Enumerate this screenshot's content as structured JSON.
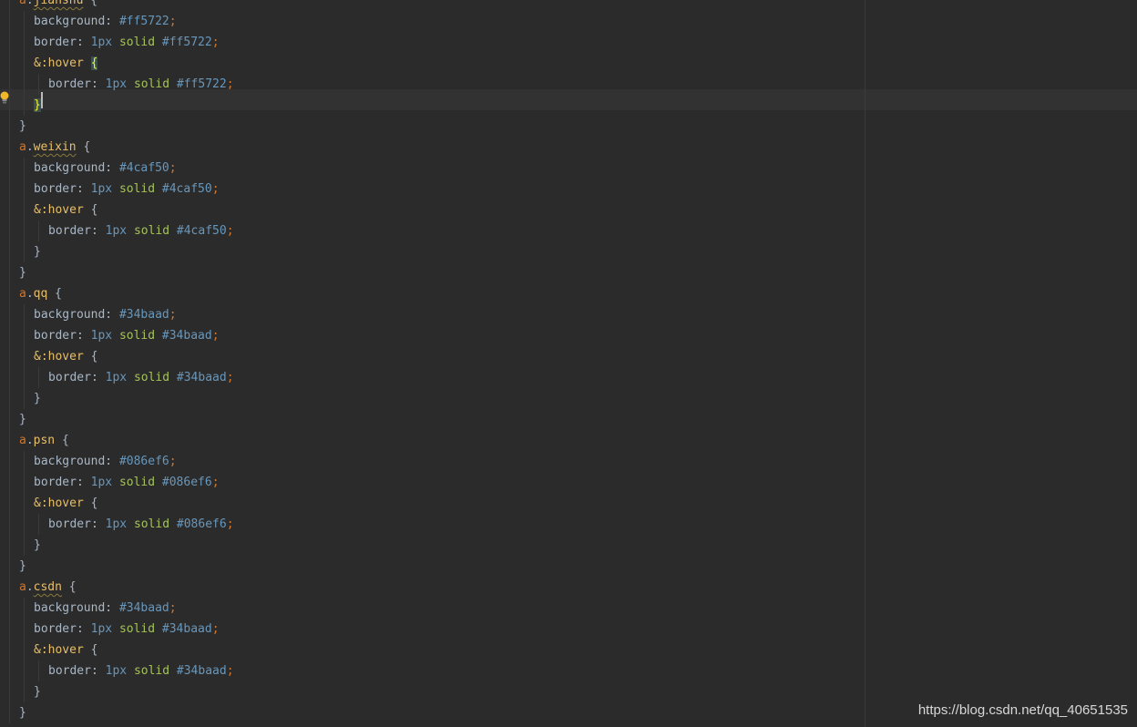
{
  "editor": {
    "language": "scss",
    "lines": [
      {
        "indent": 0,
        "tokens": [
          {
            "t": "a",
            "c": "kw"
          },
          {
            "t": ".",
            "c": "plain"
          },
          {
            "t": "jianshu",
            "c": "sel",
            "squiggle": true
          },
          {
            "t": " {",
            "c": "brace"
          }
        ]
      },
      {
        "indent": 1,
        "tokens": [
          {
            "t": "background",
            "c": "prop"
          },
          {
            "t": ": ",
            "c": "plain"
          },
          {
            "t": "#ff5722",
            "c": "hex"
          },
          {
            "t": ";",
            "c": "semi"
          }
        ]
      },
      {
        "indent": 1,
        "tokens": [
          {
            "t": "border",
            "c": "prop"
          },
          {
            "t": ": ",
            "c": "plain"
          },
          {
            "t": "1px",
            "c": "num"
          },
          {
            "t": " ",
            "c": "plain"
          },
          {
            "t": "solid",
            "c": "val"
          },
          {
            "t": " ",
            "c": "plain"
          },
          {
            "t": "#ff5722",
            "c": "hex"
          },
          {
            "t": ";",
            "c": "semi"
          }
        ]
      },
      {
        "indent": 1,
        "tokens": [
          {
            "t": "&:hover",
            "c": "sel"
          },
          {
            "t": " ",
            "c": "plain"
          },
          {
            "t": "{",
            "c": "brace-hl"
          }
        ]
      },
      {
        "indent": 2,
        "tokens": [
          {
            "t": "border",
            "c": "prop"
          },
          {
            "t": ": ",
            "c": "plain"
          },
          {
            "t": "1px",
            "c": "num"
          },
          {
            "t": " ",
            "c": "plain"
          },
          {
            "t": "solid",
            "c": "val"
          },
          {
            "t": " ",
            "c": "plain"
          },
          {
            "t": "#ff5722",
            "c": "hex"
          },
          {
            "t": ";",
            "c": "semi"
          }
        ]
      },
      {
        "indent": 1,
        "tokens": [
          {
            "t": "}",
            "c": "brace-hl"
          }
        ],
        "current": true
      },
      {
        "indent": 0,
        "tokens": [
          {
            "t": "}",
            "c": "brace"
          }
        ]
      },
      {
        "indent": 0,
        "tokens": [
          {
            "t": "a",
            "c": "kw"
          },
          {
            "t": ".",
            "c": "plain"
          },
          {
            "t": "weixin",
            "c": "sel",
            "squiggle": true
          },
          {
            "t": " {",
            "c": "brace"
          }
        ]
      },
      {
        "indent": 1,
        "tokens": [
          {
            "t": "background",
            "c": "prop"
          },
          {
            "t": ": ",
            "c": "plain"
          },
          {
            "t": "#4caf50",
            "c": "hex"
          },
          {
            "t": ";",
            "c": "semi"
          }
        ]
      },
      {
        "indent": 1,
        "tokens": [
          {
            "t": "border",
            "c": "prop"
          },
          {
            "t": ": ",
            "c": "plain"
          },
          {
            "t": "1px",
            "c": "num"
          },
          {
            "t": " ",
            "c": "plain"
          },
          {
            "t": "solid",
            "c": "val"
          },
          {
            "t": " ",
            "c": "plain"
          },
          {
            "t": "#4caf50",
            "c": "hex"
          },
          {
            "t": ";",
            "c": "semi"
          }
        ]
      },
      {
        "indent": 1,
        "tokens": [
          {
            "t": "&:hover",
            "c": "sel"
          },
          {
            "t": " {",
            "c": "brace"
          }
        ]
      },
      {
        "indent": 2,
        "tokens": [
          {
            "t": "border",
            "c": "prop"
          },
          {
            "t": ": ",
            "c": "plain"
          },
          {
            "t": "1px",
            "c": "num"
          },
          {
            "t": " ",
            "c": "plain"
          },
          {
            "t": "solid",
            "c": "val"
          },
          {
            "t": " ",
            "c": "plain"
          },
          {
            "t": "#4caf50",
            "c": "hex"
          },
          {
            "t": ";",
            "c": "semi"
          }
        ]
      },
      {
        "indent": 1,
        "tokens": [
          {
            "t": "}",
            "c": "brace"
          }
        ]
      },
      {
        "indent": 0,
        "tokens": [
          {
            "t": "}",
            "c": "brace"
          }
        ]
      },
      {
        "indent": 0,
        "tokens": [
          {
            "t": "a",
            "c": "kw"
          },
          {
            "t": ".",
            "c": "plain"
          },
          {
            "t": "qq",
            "c": "sel"
          },
          {
            "t": " {",
            "c": "brace"
          }
        ]
      },
      {
        "indent": 1,
        "tokens": [
          {
            "t": "background",
            "c": "prop"
          },
          {
            "t": ": ",
            "c": "plain"
          },
          {
            "t": "#34baad",
            "c": "hex"
          },
          {
            "t": ";",
            "c": "semi"
          }
        ]
      },
      {
        "indent": 1,
        "tokens": [
          {
            "t": "border",
            "c": "prop"
          },
          {
            "t": ": ",
            "c": "plain"
          },
          {
            "t": "1px",
            "c": "num"
          },
          {
            "t": " ",
            "c": "plain"
          },
          {
            "t": "solid",
            "c": "val"
          },
          {
            "t": " ",
            "c": "plain"
          },
          {
            "t": "#34baad",
            "c": "hex"
          },
          {
            "t": ";",
            "c": "semi"
          }
        ]
      },
      {
        "indent": 1,
        "tokens": [
          {
            "t": "&:hover",
            "c": "sel"
          },
          {
            "t": " {",
            "c": "brace"
          }
        ]
      },
      {
        "indent": 2,
        "tokens": [
          {
            "t": "border",
            "c": "prop"
          },
          {
            "t": ": ",
            "c": "plain"
          },
          {
            "t": "1px",
            "c": "num"
          },
          {
            "t": " ",
            "c": "plain"
          },
          {
            "t": "solid",
            "c": "val"
          },
          {
            "t": " ",
            "c": "plain"
          },
          {
            "t": "#34baad",
            "c": "hex"
          },
          {
            "t": ";",
            "c": "semi"
          }
        ]
      },
      {
        "indent": 1,
        "tokens": [
          {
            "t": "}",
            "c": "brace"
          }
        ]
      },
      {
        "indent": 0,
        "tokens": [
          {
            "t": "}",
            "c": "brace"
          }
        ]
      },
      {
        "indent": 0,
        "tokens": [
          {
            "t": "a",
            "c": "kw"
          },
          {
            "t": ".",
            "c": "plain"
          },
          {
            "t": "psn",
            "c": "sel"
          },
          {
            "t": " {",
            "c": "brace"
          }
        ]
      },
      {
        "indent": 1,
        "tokens": [
          {
            "t": "background",
            "c": "prop"
          },
          {
            "t": ": ",
            "c": "plain"
          },
          {
            "t": "#086ef6",
            "c": "hex"
          },
          {
            "t": ";",
            "c": "semi"
          }
        ]
      },
      {
        "indent": 1,
        "tokens": [
          {
            "t": "border",
            "c": "prop"
          },
          {
            "t": ": ",
            "c": "plain"
          },
          {
            "t": "1px",
            "c": "num"
          },
          {
            "t": " ",
            "c": "plain"
          },
          {
            "t": "solid",
            "c": "val"
          },
          {
            "t": " ",
            "c": "plain"
          },
          {
            "t": "#086ef6",
            "c": "hex"
          },
          {
            "t": ";",
            "c": "semi"
          }
        ]
      },
      {
        "indent": 1,
        "tokens": [
          {
            "t": "&:hover",
            "c": "sel"
          },
          {
            "t": " {",
            "c": "brace"
          }
        ]
      },
      {
        "indent": 2,
        "tokens": [
          {
            "t": "border",
            "c": "prop"
          },
          {
            "t": ": ",
            "c": "plain"
          },
          {
            "t": "1px",
            "c": "num"
          },
          {
            "t": " ",
            "c": "plain"
          },
          {
            "t": "solid",
            "c": "val"
          },
          {
            "t": " ",
            "c": "plain"
          },
          {
            "t": "#086ef6",
            "c": "hex"
          },
          {
            "t": ";",
            "c": "semi"
          }
        ]
      },
      {
        "indent": 1,
        "tokens": [
          {
            "t": "}",
            "c": "brace"
          }
        ]
      },
      {
        "indent": 0,
        "tokens": [
          {
            "t": "}",
            "c": "brace"
          }
        ]
      },
      {
        "indent": 0,
        "tokens": [
          {
            "t": "a",
            "c": "kw"
          },
          {
            "t": ".",
            "c": "plain"
          },
          {
            "t": "csdn",
            "c": "sel",
            "squiggle": true
          },
          {
            "t": " {",
            "c": "brace"
          }
        ]
      },
      {
        "indent": 1,
        "tokens": [
          {
            "t": "background",
            "c": "prop"
          },
          {
            "t": ": ",
            "c": "plain"
          },
          {
            "t": "#34baad",
            "c": "hex"
          },
          {
            "t": ";",
            "c": "semi"
          }
        ]
      },
      {
        "indent": 1,
        "tokens": [
          {
            "t": "border",
            "c": "prop"
          },
          {
            "t": ": ",
            "c": "plain"
          },
          {
            "t": "1px",
            "c": "num"
          },
          {
            "t": " ",
            "c": "plain"
          },
          {
            "t": "solid",
            "c": "val"
          },
          {
            "t": " ",
            "c": "plain"
          },
          {
            "t": "#34baad",
            "c": "hex"
          },
          {
            "t": ";",
            "c": "semi"
          }
        ]
      },
      {
        "indent": 1,
        "tokens": [
          {
            "t": "&:hover",
            "c": "sel"
          },
          {
            "t": " {",
            "c": "brace"
          }
        ]
      },
      {
        "indent": 2,
        "tokens": [
          {
            "t": "border",
            "c": "prop"
          },
          {
            "t": ": ",
            "c": "plain"
          },
          {
            "t": "1px",
            "c": "num"
          },
          {
            "t": " ",
            "c": "plain"
          },
          {
            "t": "solid",
            "c": "val"
          },
          {
            "t": " ",
            "c": "plain"
          },
          {
            "t": "#34baad",
            "c": "hex"
          },
          {
            "t": ";",
            "c": "semi"
          }
        ]
      },
      {
        "indent": 1,
        "tokens": [
          {
            "t": "}",
            "c": "brace"
          }
        ]
      },
      {
        "indent": 0,
        "tokens": [
          {
            "t": "}",
            "c": "brace"
          }
        ]
      },
      {
        "indent": -1,
        "tokens": [
          {
            "t": "}",
            "c": "brace"
          }
        ]
      }
    ]
  },
  "gutter": {
    "intention_icon": "lightbulb-icon"
  },
  "colors": {
    "background": "#2b2b2b",
    "current_line": "#323232",
    "keyword": "#cc7832",
    "selector": "#e8bf6a",
    "number": "#6897bb",
    "value": "#a5c25c",
    "brace_match": "#ffef28"
  },
  "watermark": {
    "text": "https://blog.csdn.net/qq_40651535"
  }
}
